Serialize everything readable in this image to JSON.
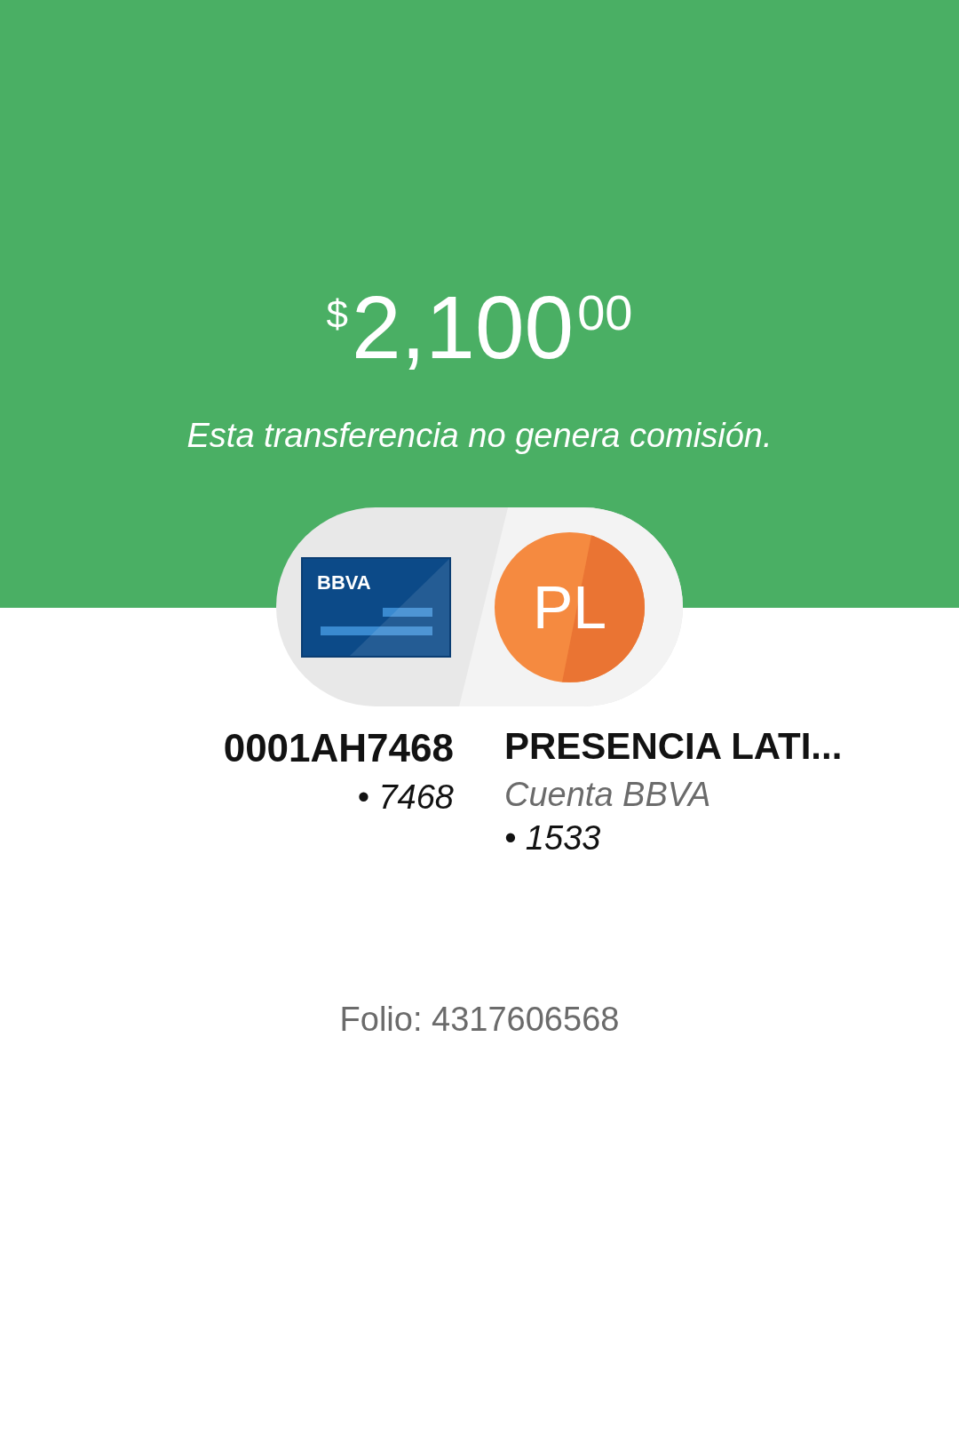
{
  "amount": {
    "currency": "$",
    "whole": "2,100",
    "cents": "00"
  },
  "note": "Esta transferencia no genera comisión.",
  "origin": {
    "card_brand": "BBVA",
    "name": "0001AH7468",
    "account": "• 7468"
  },
  "destination": {
    "initials": "PL",
    "name": "PRESENCIA LATI...",
    "bank": "Cuenta BBVA",
    "account": "• 1533"
  },
  "folio": "Folio: 4317606568"
}
